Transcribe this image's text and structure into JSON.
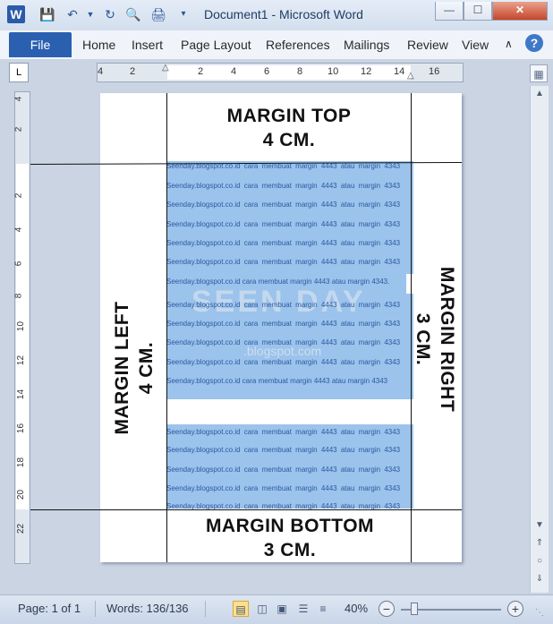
{
  "window": {
    "title": "Document1 - Microsoft Word",
    "app_icon_letter": "W",
    "minimize_glyph": "—",
    "maximize_glyph": "☐",
    "close_glyph": "✕"
  },
  "ribbon": {
    "tabs": [
      {
        "label": "File"
      },
      {
        "label": "Home"
      },
      {
        "label": "Insert"
      },
      {
        "label": "Page Layout"
      },
      {
        "label": "References"
      },
      {
        "label": "Mailings"
      },
      {
        "label": "Review"
      },
      {
        "label": "View"
      }
    ],
    "help_glyph": "?"
  },
  "ruler": {
    "corner_glyph": "L",
    "h_ticks": [
      "4",
      "2",
      "2",
      "4",
      "6",
      "8",
      "10",
      "12",
      "14",
      "16"
    ],
    "v_ticks": [
      "4",
      "2",
      "2",
      "4",
      "6",
      "8",
      "10",
      "12",
      "14",
      "16",
      "18",
      "20",
      "22"
    ]
  },
  "document": {
    "margin_top": "MARGIN TOP",
    "margin_top_value": "4 CM.",
    "margin_bottom": "MARGIN BOTTOM",
    "margin_bottom_value": "3 CM.",
    "margin_left": "MARGIN LEFT",
    "margin_left_value": "4 CM.",
    "margin_right": "MARGIN RIGHT",
    "margin_right_value": "3 CM.",
    "body_line": "Seenday.blogspot.co.id cara membuat margin 4443 atau margin 4343",
    "body_line_short": "Seenday.blogspot.co.id cara membuat margin 4443 atau margin 4343.",
    "watermark": "SEEN DAY",
    "watermark_sub": ".blogspot.com"
  },
  "status": {
    "page": "Page: 1 of 1",
    "words": "Words: 136/136",
    "zoom": "40%",
    "zoom_minus": "−",
    "zoom_plus": "+",
    "zoom_fraction": 0.13
  },
  "colors": {
    "selection": "#9bc3ec",
    "file_tab": "#2b60b0",
    "title_text": "#1e3a5f"
  }
}
